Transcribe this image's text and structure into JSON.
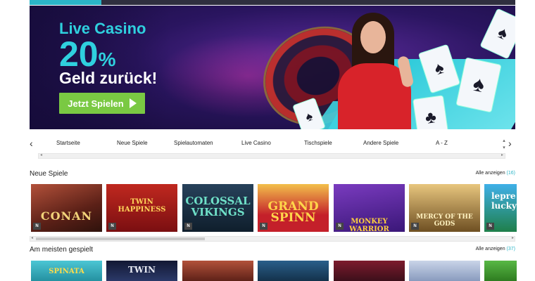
{
  "banner": {
    "title": "Live Casino",
    "percent": "20",
    "percent_sign": "%",
    "subtitle": "Geld zurück!",
    "cta_label": "Jetzt Spielen",
    "cta_icon": "play-icon",
    "colors": {
      "accent": "#2fd0de",
      "cta": "#7ac943",
      "background": "#2a1560"
    }
  },
  "nav": {
    "prev_icon": "chevron-left-icon",
    "next_icon": "chevron-right-icon",
    "items": [
      "Startseite",
      "Neue Spiele",
      "Spielautomaten",
      "Live Casino",
      "Tischspiele",
      "Andere Spiele",
      "A - Z"
    ]
  },
  "sections": [
    {
      "title": "Neue Spiele",
      "show_all_label": "Alle anzeigen",
      "show_all_count": "(16)",
      "games": [
        {
          "name": "CONAN",
          "badge": "N"
        },
        {
          "name": "TWIN HAPPINESS",
          "badge": "N"
        },
        {
          "name": "COLOSSAL VIKINGS",
          "badge": "N"
        },
        {
          "name": "GRAND SPINN",
          "badge": "N"
        },
        {
          "name": "MONKEY WARRIOR",
          "badge": "N"
        },
        {
          "name": "MERCY OF THE GODS",
          "badge": "N"
        },
        {
          "name": "lepre lucky",
          "badge": "N"
        }
      ]
    },
    {
      "title": "Am meisten gespielt",
      "show_all_label": "Alle anzeigen",
      "show_all_count": "(37)",
      "games": [
        {
          "name": "SPINATA"
        },
        {
          "name": "TWIN"
        },
        {
          "name": ""
        },
        {
          "name": ""
        },
        {
          "name": ""
        },
        {
          "name": ""
        },
        {
          "name": ""
        }
      ]
    }
  ]
}
